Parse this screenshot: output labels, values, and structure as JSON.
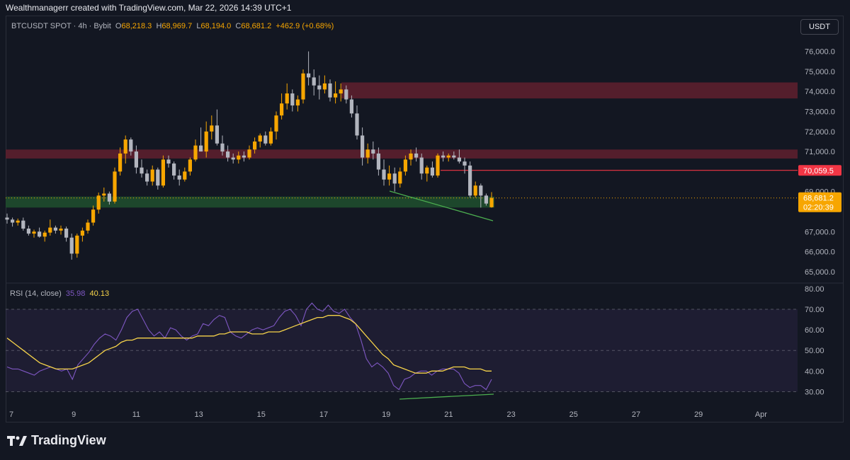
{
  "caption": "Wealthmanagerr created with TradingView.com, Mar 22, 2026 14:39 UTC+1",
  "legend": {
    "symbol": "BTCUSDT SPOT · 4h · Bybit",
    "open_label": "O",
    "open": "68,218.3",
    "high_label": "H",
    "high": "68,969.7",
    "low_label": "L",
    "low": "68,194.0",
    "close_label": "C",
    "close": "68,681.2",
    "change": "+462.9 (+0.68%)"
  },
  "currency_button": "USDT",
  "rsi_legend": {
    "label": "RSI (14, close)",
    "rsi_value": "35.98",
    "ma_value": "40.13"
  },
  "brand": "TradingView",
  "colors": {
    "up": "#f7a600",
    "down": "#b2b5be",
    "resistance_zone": "#5c1f2e",
    "support_zone": "#1f4d2e",
    "level_line": "#f23645",
    "divergence": "#4caf50",
    "rsi": "#7e57c2",
    "rsi_ma": "#f7d44a"
  },
  "chart_data": [
    {
      "type": "candlestick",
      "y_axis_ticks": [
        "76,000.0",
        "75,000.0",
        "74,000.0",
        "73,000.0",
        "72,000.0",
        "71,000.0",
        "69,000.0",
        "67,000.0",
        "66,000.0",
        "65,000.0"
      ],
      "ylim": [
        64500,
        76800
      ],
      "x_axis_ticks": [
        "7",
        "9",
        "11",
        "13",
        "15",
        "17",
        "19",
        "21",
        "23",
        "25",
        "27",
        "29",
        "Apr"
      ],
      "price_labels": {
        "level": "70,059.5",
        "last_price": "68,681.2",
        "countdown": "02:20:39"
      },
      "level_line": 70059.5,
      "zones": [
        {
          "kind": "resistance",
          "from": 73650,
          "to": 74450
        },
        {
          "kind": "resistance",
          "from": 70650,
          "to": 71100
        },
        {
          "kind": "support",
          "from": 68200,
          "to": 68750
        }
      ],
      "candles_ohlc": [
        [
          67700,
          67900,
          67400,
          67600
        ],
        [
          67600,
          67700,
          67250,
          67450
        ],
        [
          67450,
          67650,
          67300,
          67550
        ],
        [
          67550,
          67700,
          67050,
          67150
        ],
        [
          67150,
          67300,
          66800,
          66900
        ],
        [
          66900,
          67100,
          66700,
          67000
        ],
        [
          67000,
          67200,
          66700,
          66750
        ],
        [
          66750,
          67050,
          66500,
          66950
        ],
        [
          66950,
          67600,
          66800,
          67200
        ],
        [
          67200,
          67300,
          66900,
          67050
        ],
        [
          67050,
          67300,
          66850,
          67150
        ],
        [
          67150,
          67250,
          66500,
          66700
        ],
        [
          66700,
          66900,
          65600,
          65900
        ],
        [
          65900,
          66900,
          65700,
          66800
        ],
        [
          66800,
          67200,
          66500,
          67050
        ],
        [
          67050,
          67600,
          66900,
          67450
        ],
        [
          67450,
          68300,
          67300,
          68100
        ],
        [
          68100,
          68950,
          67900,
          68800
        ],
        [
          68800,
          69200,
          68500,
          68900
        ],
        [
          68900,
          69000,
          68350,
          68500
        ],
        [
          68500,
          70200,
          68400,
          70000
        ],
        [
          70000,
          71200,
          69800,
          70900
        ],
        [
          70900,
          71800,
          70400,
          71600
        ],
        [
          71600,
          71700,
          70800,
          71000
        ],
        [
          71000,
          71300,
          69900,
          70200
        ],
        [
          70200,
          70600,
          69700,
          69900
        ],
        [
          69900,
          70100,
          69300,
          69500
        ],
        [
          69500,
          70300,
          69300,
          70100
        ],
        [
          70100,
          70200,
          69100,
          69300
        ],
        [
          69300,
          70800,
          69200,
          70600
        ],
        [
          70600,
          70800,
          70200,
          70400
        ],
        [
          70400,
          70500,
          69600,
          69800
        ],
        [
          69800,
          70100,
          69300,
          69600
        ],
        [
          69600,
          70200,
          69500,
          70000
        ],
        [
          70000,
          70700,
          69800,
          70600
        ],
        [
          70600,
          71600,
          70500,
          71300
        ],
        [
          71300,
          72200,
          71000,
          71000
        ],
        [
          71000,
          72500,
          70700,
          72000
        ],
        [
          72000,
          72800,
          71600,
          72300
        ],
        [
          72300,
          73100,
          71300,
          71400
        ],
        [
          71400,
          71800,
          70800,
          71000
        ],
        [
          71000,
          71300,
          70500,
          70700
        ],
        [
          70700,
          70900,
          70400,
          70600
        ],
        [
          70600,
          71000,
          70400,
          70800
        ],
        [
          70800,
          71000,
          70500,
          70700
        ],
        [
          70700,
          71300,
          70600,
          71100
        ],
        [
          71100,
          71700,
          70900,
          71500
        ],
        [
          71500,
          71900,
          71200,
          71800
        ],
        [
          71800,
          72000,
          71300,
          71400
        ],
        [
          71400,
          72200,
          71300,
          72000
        ],
        [
          72000,
          73000,
          71600,
          72800
        ],
        [
          72800,
          73900,
          72600,
          73400
        ],
        [
          73400,
          74400,
          73100,
          73900
        ],
        [
          73900,
          74100,
          73000,
          73300
        ],
        [
          73300,
          73800,
          73000,
          73600
        ],
        [
          73600,
          75100,
          73400,
          74900
        ],
        [
          74900,
          76000,
          74300,
          74700
        ],
        [
          74700,
          75100,
          73800,
          74300
        ],
        [
          74300,
          74800,
          73600,
          74100
        ],
        [
          74100,
          74800,
          73900,
          74400
        ],
        [
          74400,
          74600,
          73500,
          73700
        ],
        [
          73700,
          74500,
          73400,
          73900
        ],
        [
          73900,
          74400,
          73500,
          74100
        ],
        [
          74100,
          74300,
          73400,
          73600
        ],
        [
          73600,
          73800,
          72700,
          72900
        ],
        [
          72900,
          73300,
          71600,
          71800
        ],
        [
          71800,
          72200,
          70300,
          70700
        ],
        [
          70700,
          71400,
          70400,
          71100
        ],
        [
          71100,
          71500,
          70600,
          70900
        ],
        [
          70900,
          71200,
          69800,
          70100
        ],
        [
          70100,
          70600,
          69300,
          69600
        ],
        [
          69600,
          70300,
          69300,
          69900
        ],
        [
          69900,
          70200,
          69000,
          69400
        ],
        [
          69400,
          70200,
          69200,
          70000
        ],
        [
          70000,
          70800,
          69800,
          70600
        ],
        [
          70600,
          71100,
          70300,
          70900
        ],
        [
          70900,
          71200,
          70500,
          70700
        ],
        [
          70700,
          70900,
          69600,
          69900
        ],
        [
          69900,
          70300,
          69500,
          70200
        ],
        [
          70200,
          70500,
          69700,
          69800
        ],
        [
          69800,
          70900,
          69700,
          70800
        ],
        [
          70800,
          71000,
          70500,
          70700
        ],
        [
          70700,
          70900,
          70500,
          70800
        ],
        [
          70800,
          71000,
          70600,
          70700
        ],
        [
          70700,
          71100,
          70400,
          70500
        ],
        [
          70500,
          70700,
          69900,
          70300
        ],
        [
          70300,
          70500,
          68700,
          68800
        ],
        [
          68800,
          69500,
          68700,
          69300
        ],
        [
          69300,
          69400,
          68200,
          68800
        ],
        [
          68800,
          68900,
          68300,
          68400
        ],
        [
          68218.3,
          68969.7,
          68194.0,
          68681.2
        ]
      ]
    },
    {
      "type": "line",
      "title": "RSI (14, close)",
      "y_axis_ticks": [
        "80.00",
        "70.00",
        "60.00",
        "50.00",
        "40.00",
        "30.00"
      ],
      "ylim": [
        25,
        82
      ],
      "band": [
        30,
        70
      ],
      "midline": 50,
      "series": [
        {
          "name": "RSI",
          "values": [
            42,
            41,
            41,
            40,
            39,
            38,
            40,
            41,
            42,
            41,
            40,
            41,
            36,
            43,
            46,
            49,
            53,
            56,
            58,
            57,
            55,
            60,
            66,
            69,
            70,
            65,
            60,
            57,
            59,
            56,
            61,
            60,
            57,
            55,
            57,
            58,
            63,
            62,
            65,
            67,
            66,
            59,
            57,
            56,
            58,
            60,
            61,
            60,
            61,
            62,
            66,
            69,
            70,
            67,
            62,
            70,
            73,
            70,
            69,
            72,
            69,
            68,
            70,
            66,
            63,
            55,
            46,
            42,
            44,
            42,
            39,
            33,
            31,
            36,
            37,
            39,
            40,
            40,
            38,
            40,
            41,
            41,
            41,
            39,
            34,
            32,
            33,
            33,
            31,
            36
          ]
        },
        {
          "name": "RSI-based MA",
          "values": [
            56,
            54,
            52,
            50,
            48,
            46,
            44,
            43,
            42,
            41,
            41,
            41,
            41,
            42,
            43,
            44,
            46,
            48,
            50,
            51,
            52,
            54,
            55,
            55,
            56,
            56,
            56,
            56,
            56,
            56,
            56,
            56,
            56,
            56,
            56,
            57,
            57,
            57,
            57,
            58,
            58,
            59,
            59,
            59,
            59,
            58,
            58,
            58,
            59,
            59,
            59,
            60,
            61,
            62,
            63,
            64,
            65,
            66,
            66,
            67,
            67,
            67,
            66,
            65,
            63,
            60,
            57,
            54,
            51,
            48,
            46,
            43,
            42,
            41,
            40,
            39,
            39,
            39,
            40,
            40,
            40,
            41,
            42,
            42,
            42,
            41,
            41,
            41,
            40,
            40
          ]
        }
      ]
    }
  ]
}
